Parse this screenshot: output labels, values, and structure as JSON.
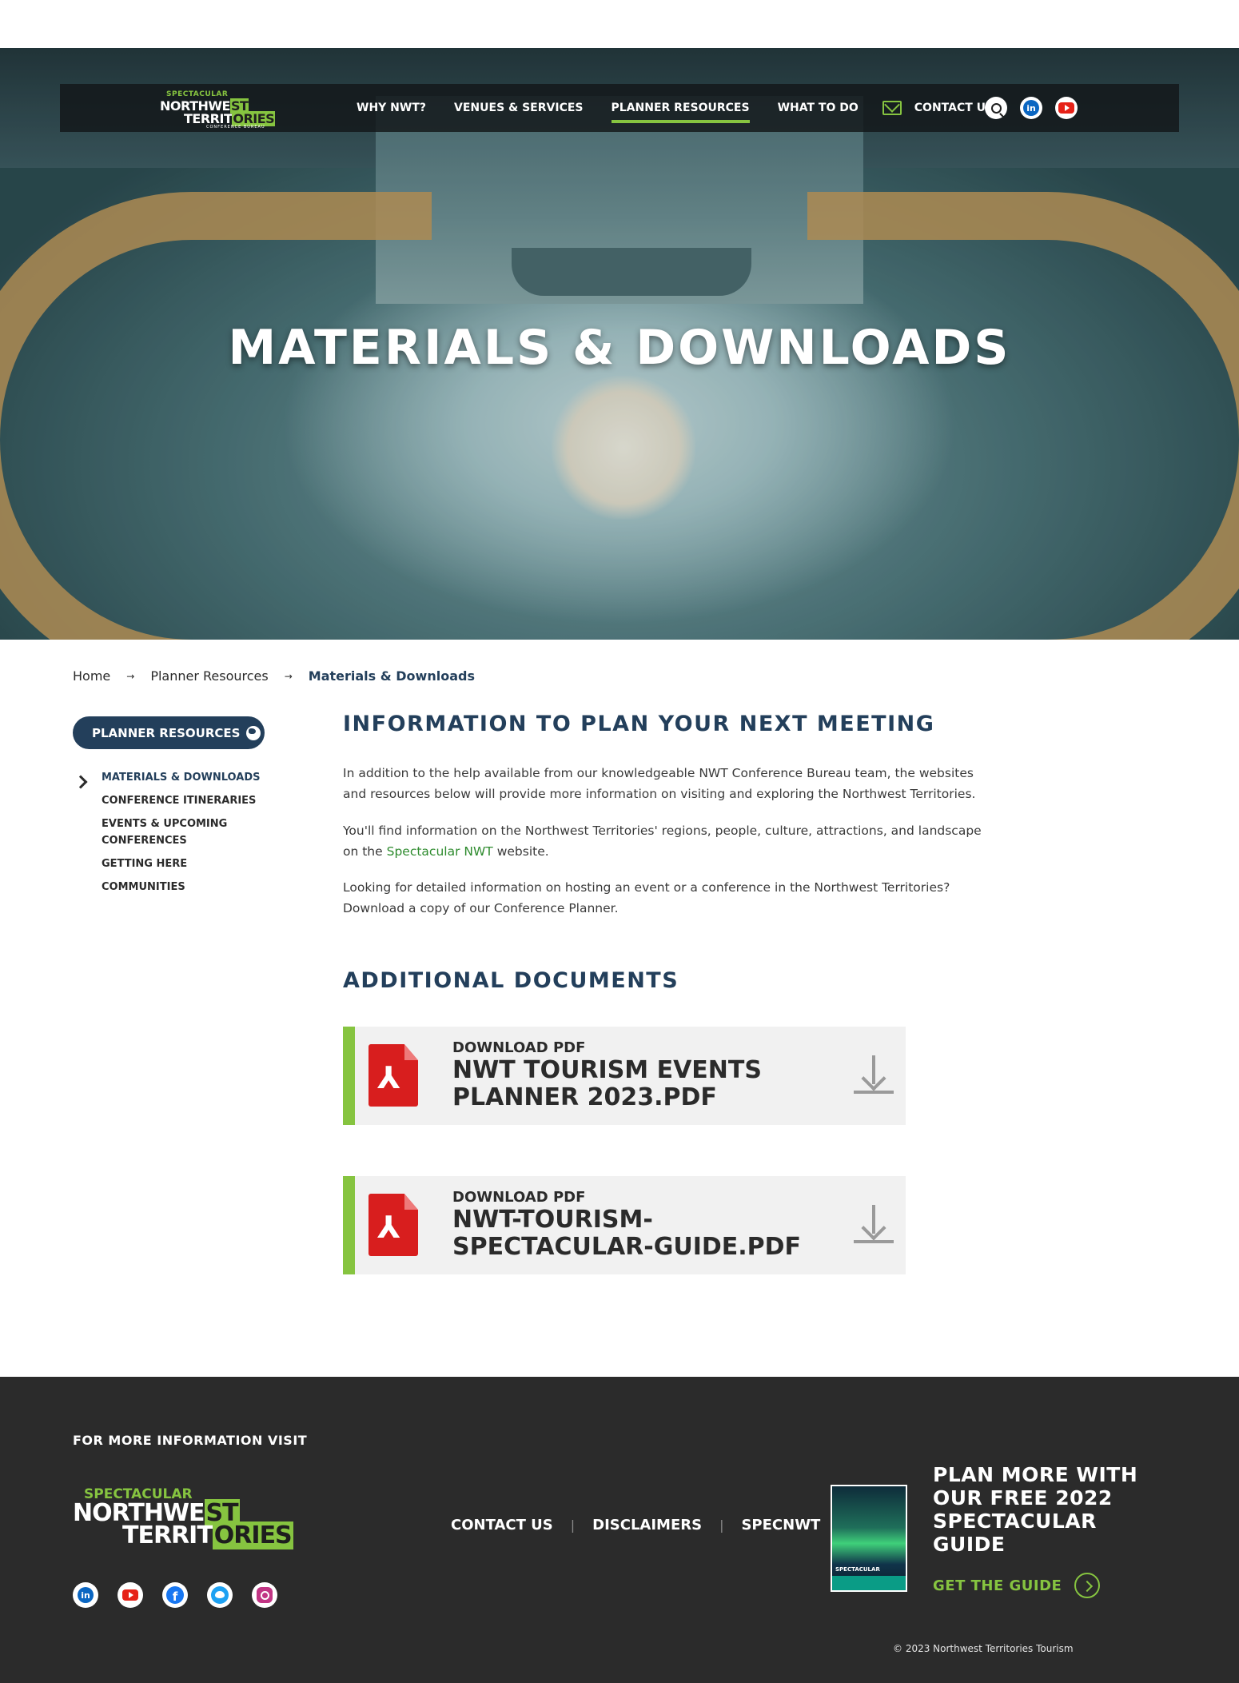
{
  "nav": {
    "logo": {
      "line1": "SPECTACULAR",
      "line2a": "NORTHWE",
      "line2b": "ST",
      "line3a": "TERRIT",
      "line3b": "ORIES",
      "line4": "CONFERENCE BUREAU"
    },
    "links": [
      "WHY NWT?",
      "VENUES & SERVICES",
      "PLANNER RESOURCES",
      "WHAT TO DO"
    ],
    "active_link": "PLANNER RESOURCES",
    "contact_label": "CONTACT US",
    "icons": [
      "search-icon",
      "linkedin-icon",
      "youtube-icon"
    ],
    "linkedin_text": "in"
  },
  "hero": {
    "title": "MATERIALS & DOWNLOADS"
  },
  "breadcrumb": {
    "items": [
      "Home",
      "Planner Resources"
    ],
    "current": "Materials & Downloads",
    "separator": "→"
  },
  "sidebar": {
    "button_label": "PLANNER RESOURCES",
    "items": [
      "MATERIALS & DOWNLOADS",
      "CONFERENCE ITINERARIES",
      "EVENTS & UPCOMING CONFERENCES",
      "GETTING HERE",
      "COMMUNITIES"
    ],
    "active_item": "MATERIALS & DOWNLOADS"
  },
  "main": {
    "heading": "INFORMATION TO PLAN YOUR NEXT MEETING",
    "para1": "In addition to the help available from our knowledgeable NWT Conference Bureau team, the websites and resources below will provide more information on visiting and exploring the Northwest Territories.",
    "para2_before": "You'll find information on the Northwest Territories' regions, people, culture, attractions, and landscape on the ",
    "para2_link": "Spectacular NWT",
    "para2_after": " website.",
    "para3": "Looking for detailed information on hosting an event or a conference in the Northwest Territories? Download a copy of our Conference Planner.",
    "docs_heading": "ADDITIONAL DOCUMENTS",
    "documents": [
      {
        "kicker": "DOWNLOAD PDF",
        "title": "NWT TOURISM EVENTS PLANNER 2023.PDF"
      },
      {
        "kicker": "DOWNLOAD PDF",
        "title": "NWT-TOURISM-SPECTACULAR-GUIDE.PDF"
      }
    ]
  },
  "footer": {
    "title": "FOR MORE INFORMATION VISIT",
    "logo": {
      "line1": "SPECTACULAR",
      "line2a": "NORTHWE",
      "line2b": "ST",
      "line3a": "TERRIT",
      "line3b": "ORIES"
    },
    "links": [
      "CONTACT US",
      "DISCLAIMERS",
      "SPECNWT"
    ],
    "separator": "|",
    "social_icons": [
      "linkedin-icon",
      "youtube-icon",
      "facebook-icon",
      "twitter-icon",
      "instagram-icon"
    ],
    "linkedin_text": "in",
    "facebook_text": "f",
    "guide_cover_text": "SPECTACULAR",
    "plan_text": "PLAN MORE WITH OUR FREE 2022 SPECTACULAR GUIDE",
    "guide_link": "GET THE GUIDE",
    "copyright": "© 2023 Northwest Territories Tourism"
  },
  "colors": {
    "accent_green": "#86c440",
    "navy": "#233f5b",
    "footer_bg": "#2b2b2b",
    "pdf_red": "#d81e1e"
  }
}
